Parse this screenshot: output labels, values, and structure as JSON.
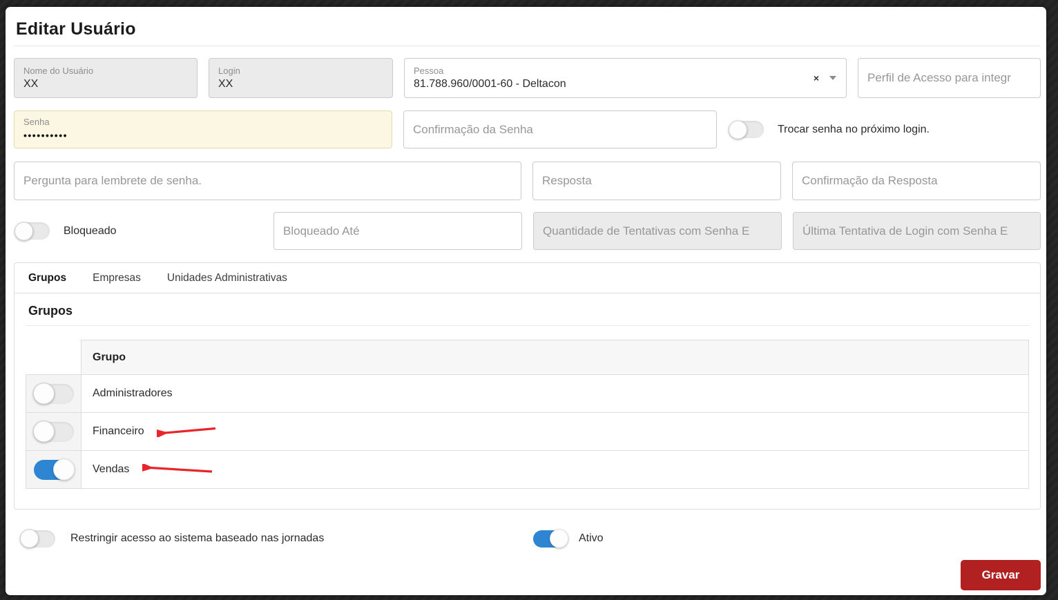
{
  "title": "Editar Usuário",
  "icons": {
    "clear": "×",
    "caret": "caret-down"
  },
  "fields": {
    "nome": {
      "label": "Nome do Usuário",
      "value": "XX"
    },
    "login": {
      "label": "Login",
      "value": "XX"
    },
    "pessoa": {
      "label": "Pessoa",
      "value": "81.788.960/0001-60 - Deltacon"
    },
    "perfil": {
      "placeholder": "Perfil de Acesso para integr"
    },
    "senha": {
      "label": "Senha",
      "value": "••••••••••"
    },
    "confirmacao_senha": {
      "placeholder": "Confirmação da Senha"
    },
    "trocar_senha": {
      "label": "Trocar senha no próximo login.",
      "on": false
    },
    "pergunta": {
      "placeholder": "Pergunta para lembrete de senha."
    },
    "resposta": {
      "placeholder": "Resposta"
    },
    "confirmacao_resposta": {
      "placeholder": "Confirmação da Resposta"
    },
    "bloqueado": {
      "label": "Bloqueado",
      "on": false
    },
    "bloqueado_ate": {
      "placeholder": "Bloqueado Até"
    },
    "qtd_tentativas": {
      "placeholder": "Quantidade de Tentativas com Senha E"
    },
    "ultima_tentativa": {
      "placeholder": "Última Tentativa de Login com Senha E"
    }
  },
  "tabs": [
    {
      "label": "Grupos",
      "active": true
    },
    {
      "label": "Empresas",
      "active": false
    },
    {
      "label": "Unidades Administrativas",
      "active": false
    }
  ],
  "groups_section": {
    "heading": "Grupos",
    "table": {
      "column_header": "Grupo",
      "rows": [
        {
          "name": "Administradores",
          "enabled": false,
          "annotated": false
        },
        {
          "name": "Financeiro",
          "enabled": false,
          "annotated": true
        },
        {
          "name": "Vendas",
          "enabled": true,
          "annotated": true
        }
      ]
    }
  },
  "footer": {
    "restringir": {
      "label": "Restringir acesso ao sistema baseado nas jornadas",
      "on": false
    },
    "ativo": {
      "label": "Ativo",
      "on": true
    },
    "save_button": "Gravar"
  },
  "colors": {
    "toggle_on_blue": "#2e86d3",
    "save_red": "#b12121",
    "arrow_red": "#e8252a",
    "senha_bg": "#fbf7e3"
  }
}
